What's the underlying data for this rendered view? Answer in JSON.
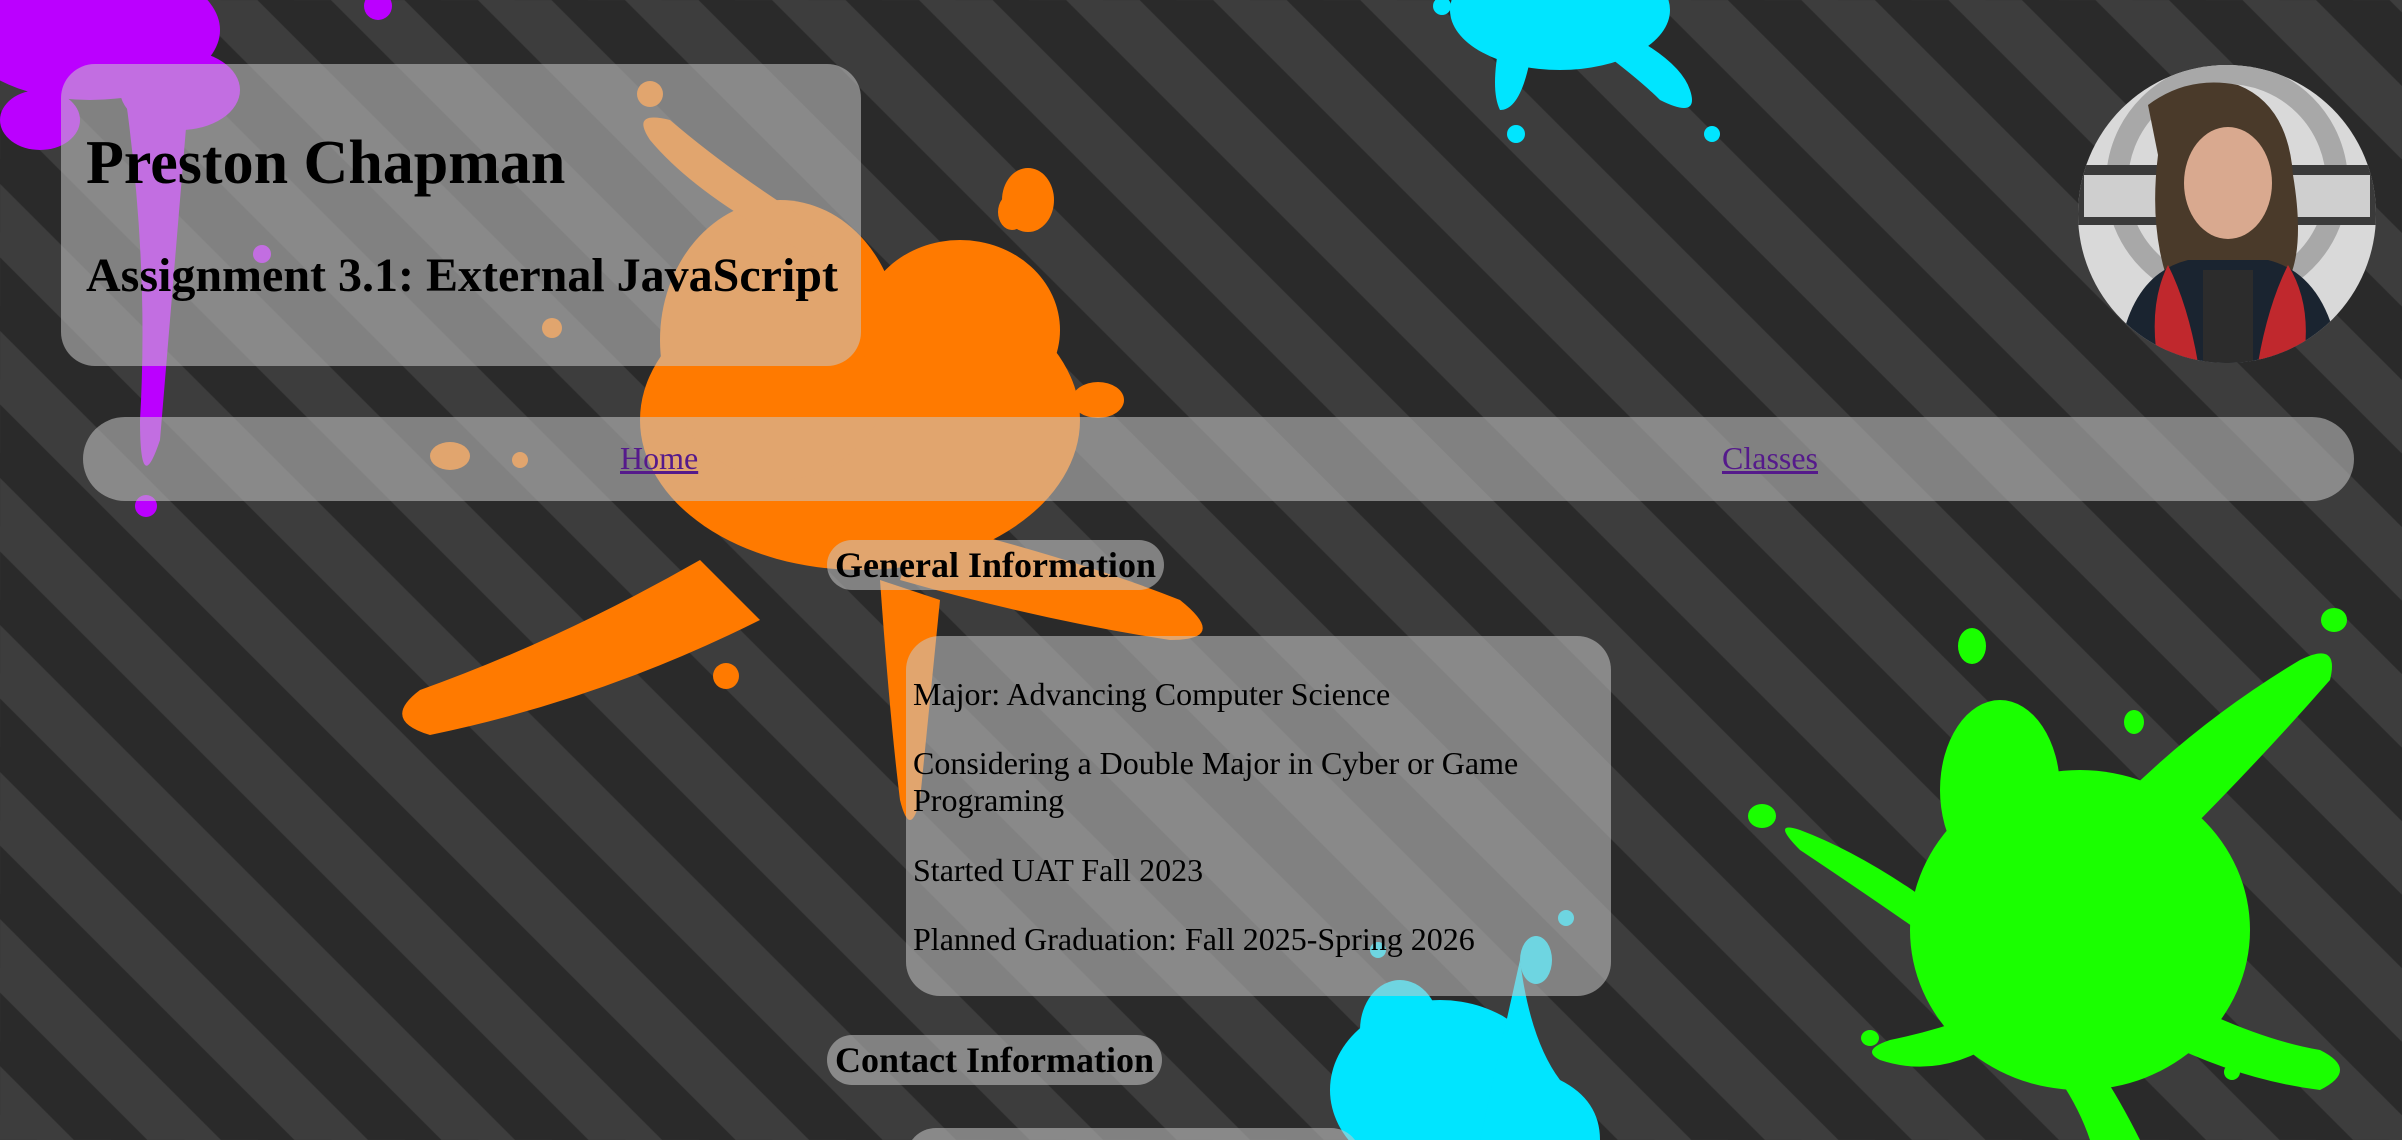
{
  "header": {
    "title": "Preston Chapman",
    "subtitle": "Assignment 3.1: External JavaScript"
  },
  "avatar": {
    "alt": "Profile photo"
  },
  "nav": {
    "home_label": "Home",
    "classes_label": "Classes"
  },
  "sections": {
    "general_heading": "General Information",
    "contact_heading": "Contact Information"
  },
  "general_info": [
    "Major: Advancing Computer Science",
    "Considering a Double Major in Cyber or Game Programing",
    "Started UAT Fall 2023",
    "Planned Graduation: Fall 2025-Spring 2026"
  ],
  "colors": {
    "background_dark": "#2a2a2a",
    "background_stripe": "#3d3d3d",
    "splat_purple": "#bb00ff",
    "splat_orange": "#ff7a00",
    "splat_cyan": "#00e5ff",
    "splat_green": "#1aff00",
    "link_color": "#551a8b"
  }
}
